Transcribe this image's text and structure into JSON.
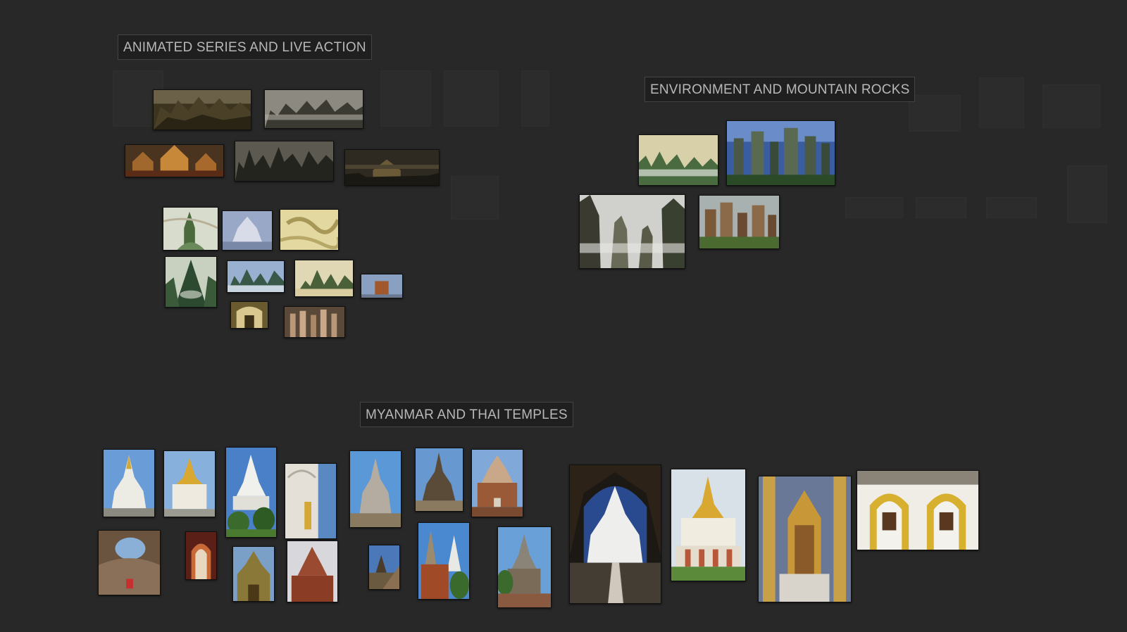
{
  "board": {
    "sections": [
      {
        "id": "animated",
        "title": "ANIMATED SERIES AND LIVE ACTION"
      },
      {
        "id": "environment",
        "title": "ENVIRONMENT AND MOUNTAIN ROCKS"
      },
      {
        "id": "temples",
        "title": "MYANMAR AND THAI TEMPLES"
      }
    ]
  },
  "palette": {
    "background": "#282828",
    "title_bg": "#1f1f1f",
    "title_text": "#b8b8b8",
    "title_border": "#444444"
  }
}
